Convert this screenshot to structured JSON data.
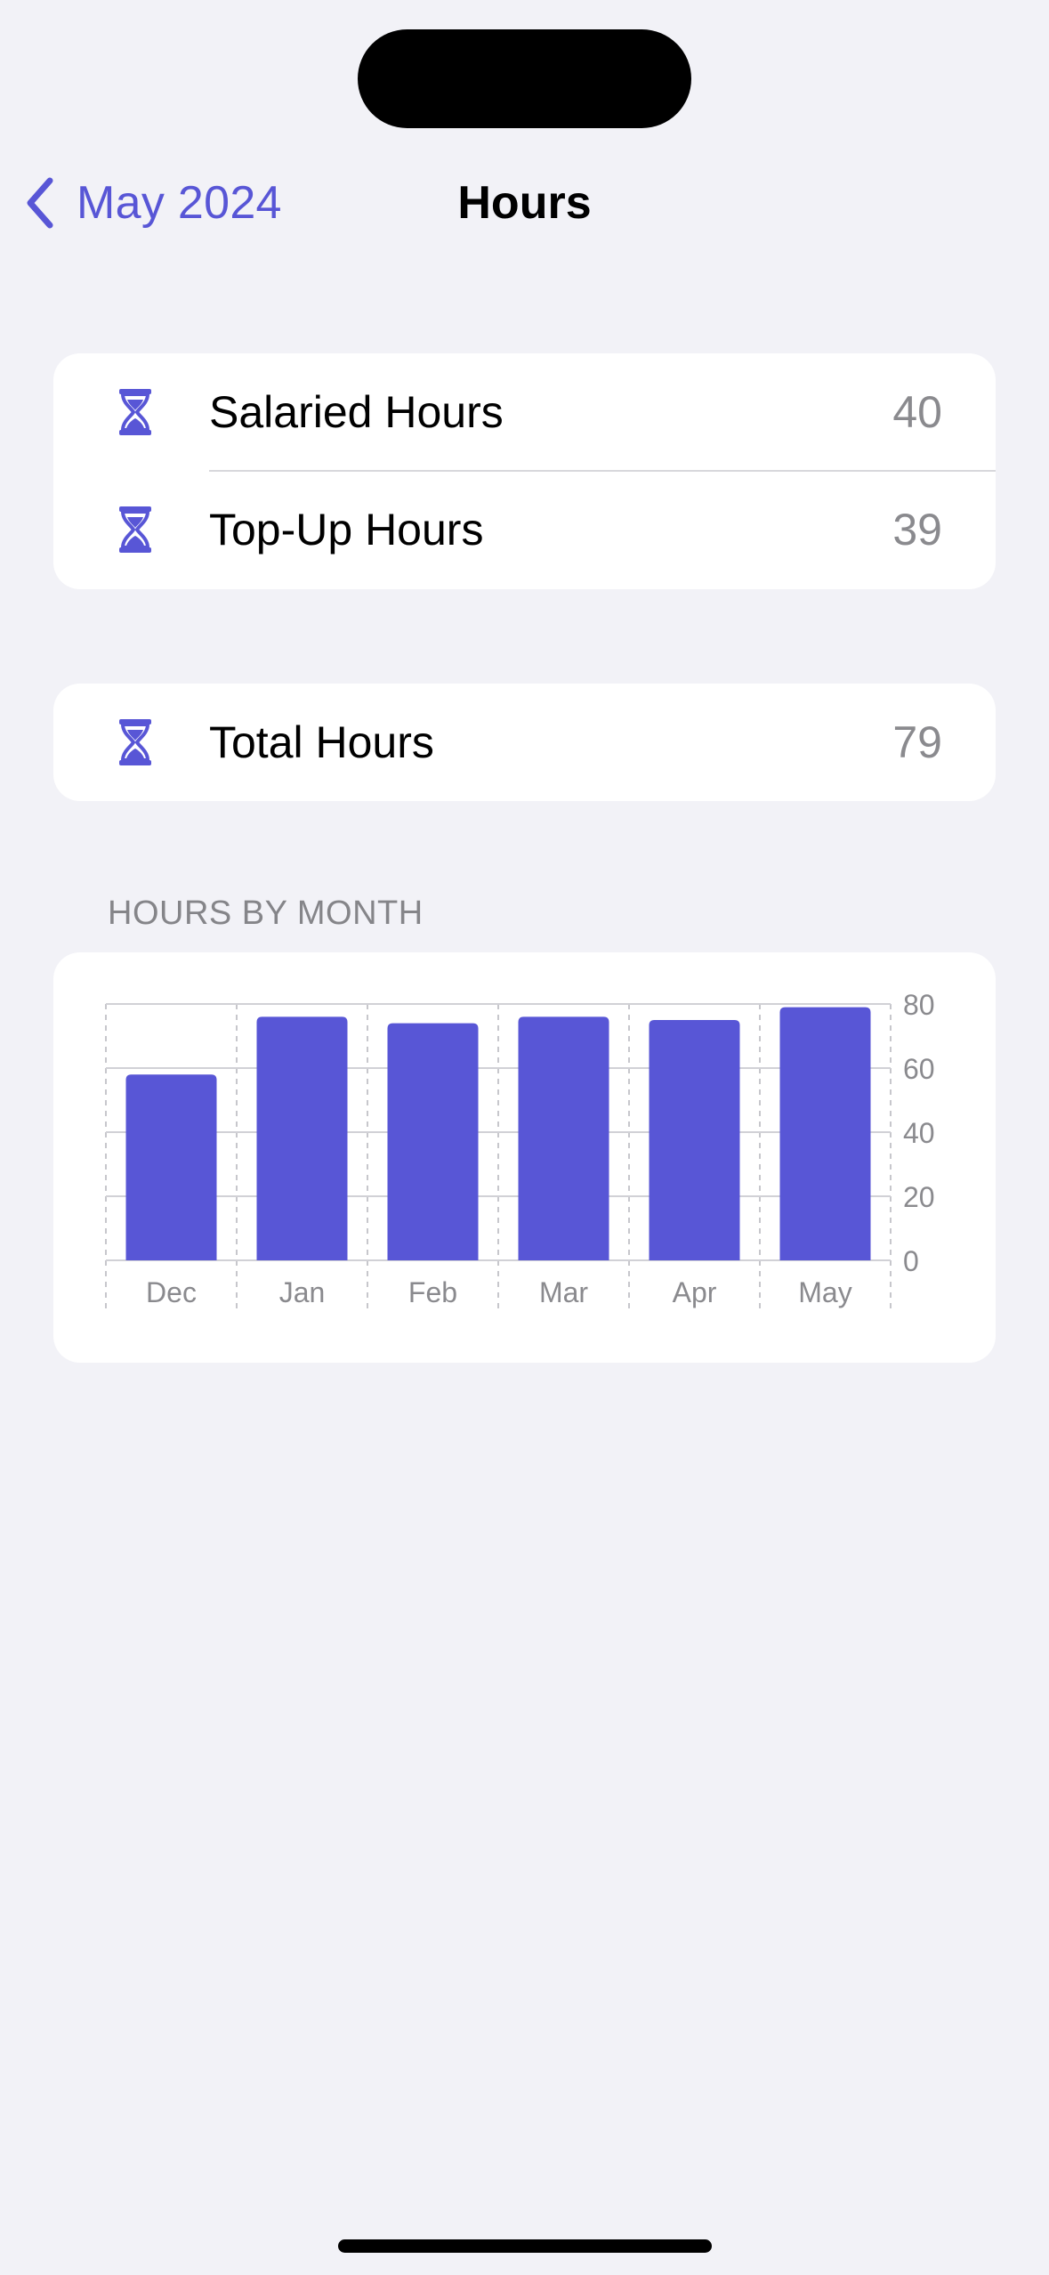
{
  "nav": {
    "back_label": "May 2024",
    "title": "Hours"
  },
  "hours_card": {
    "rows": [
      {
        "label": "Salaried Hours",
        "value": "40",
        "icon": "hourglass-icon"
      },
      {
        "label": "Top-Up Hours",
        "value": "39",
        "icon": "hourglass-icon"
      }
    ]
  },
  "total_card": {
    "label": "Total Hours",
    "value": "79",
    "icon": "hourglass-icon"
  },
  "chart_section": {
    "header": "HOURS BY MONTH"
  },
  "colors": {
    "accent": "#5856d6",
    "background": "#f2f2f7",
    "secondary_text": "#8a8a8e"
  },
  "chart_data": {
    "type": "bar",
    "categories": [
      "Dec",
      "Jan",
      "Feb",
      "Mar",
      "Apr",
      "May"
    ],
    "values": [
      58,
      76,
      74,
      76,
      75,
      79
    ],
    "ylim": [
      0,
      80
    ],
    "yticks": [
      0,
      20,
      40,
      60,
      80
    ],
    "y_axis_position": "right",
    "grid": true,
    "color": "#5856d6"
  }
}
